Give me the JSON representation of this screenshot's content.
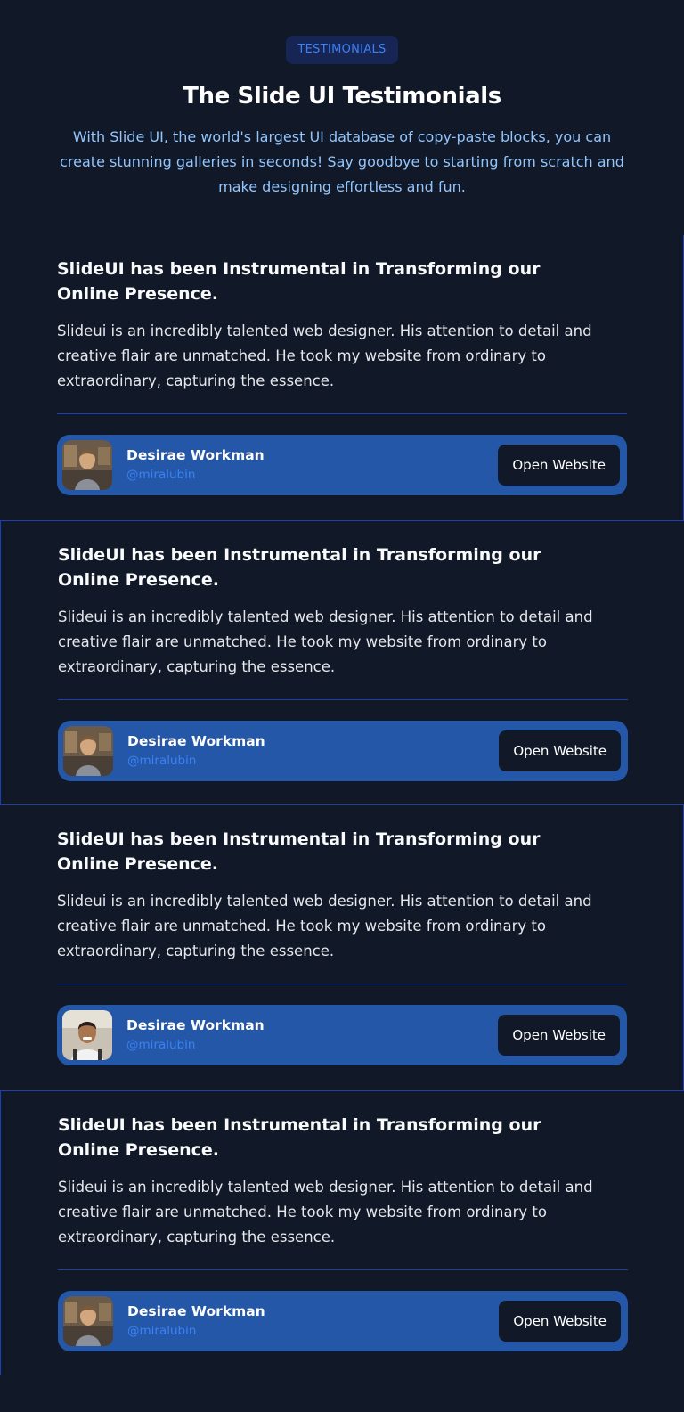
{
  "header": {
    "eyebrow": "TESTIMONIALS",
    "title": "The Slide UI Testimonials",
    "subtitle": "With Slide UI, the world's largest UI database of copy-paste blocks, you can create stunning galleries in seconds! Say goodbye to starting from scratch and make designing effortless and fun."
  },
  "testimonials": [
    {
      "heading": "SlideUI has been Instrumental in Transforming our Online Presence.",
      "quote": "Slideui is an incredibly talented web designer. His attention to detail and creative flair are unmatched. He took my website from ordinary to extraordinary, capturing the essence.",
      "author_name": "Desirae Workman",
      "author_handle": "@miralubin",
      "button_label": "Open Website"
    },
    {
      "heading": "SlideUI has been Instrumental in Transforming our Online Presence.",
      "quote": "Slideui is an incredibly talented web designer. His attention to detail and creative flair are unmatched. He took my website from ordinary to extraordinary, capturing the essence.",
      "author_name": "Desirae Workman",
      "author_handle": "@miralubin",
      "button_label": "Open Website"
    },
    {
      "heading": "SlideUI has been Instrumental in Transforming our Online Presence.",
      "quote": "Slideui is an incredibly talented web designer. His attention to detail and creative flair are unmatched. He took my website from ordinary to extraordinary, capturing the essence.",
      "author_name": "Desirae Workman",
      "author_handle": "@miralubin",
      "button_label": "Open Website"
    },
    {
      "heading": "SlideUI has been Instrumental in Transforming our Online Presence.",
      "quote": "Slideui is an incredibly talented web designer. His attention to detail and creative flair are unmatched. He took my website from ordinary to extraordinary, capturing the essence.",
      "author_name": "Desirae Workman",
      "author_handle": "@miralubin",
      "button_label": "Open Website"
    }
  ],
  "colors": {
    "background": "#111827",
    "accent": "#3b82f6",
    "author_bar": "#2457a7",
    "border": "#1e40af",
    "subtitle": "#93c5fd"
  }
}
